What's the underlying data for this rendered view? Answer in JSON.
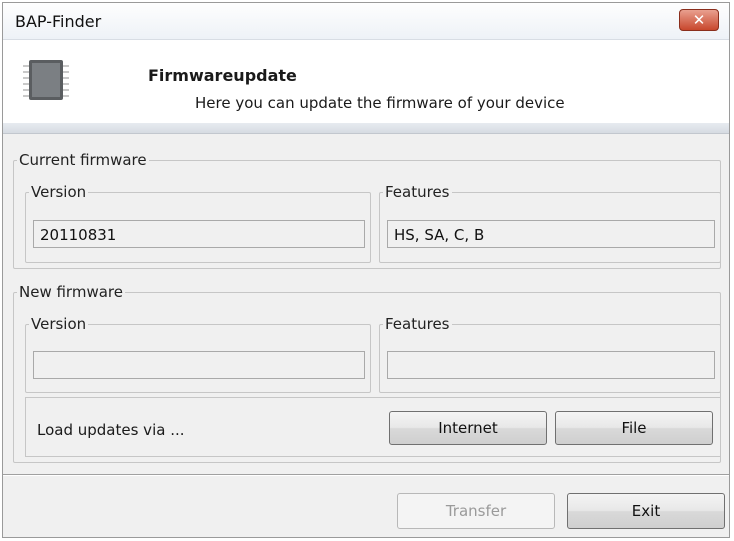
{
  "window": {
    "title": "BAP-Finder",
    "close_label": "✕"
  },
  "header": {
    "title": "Firmwareupdate",
    "subtitle": "Here you can update the firmware of your device",
    "icon": "chip-icon"
  },
  "current_firmware": {
    "legend": "Current firmware",
    "version": {
      "legend": "Version",
      "value": "20110831"
    },
    "features": {
      "legend": "Features",
      "value": "HS, SA, C, B"
    }
  },
  "new_firmware": {
    "legend": "New firmware",
    "version": {
      "legend": "Version",
      "value": ""
    },
    "features": {
      "legend": "Features",
      "value": ""
    },
    "load_via_label": "Load updates via ...",
    "internet_button": "Internet",
    "file_button": "File"
  },
  "footer": {
    "transfer_button": "Transfer",
    "exit_button": "Exit"
  },
  "colors": {
    "close_button": "#c8472d",
    "window_bg": "#f0f0f0"
  }
}
